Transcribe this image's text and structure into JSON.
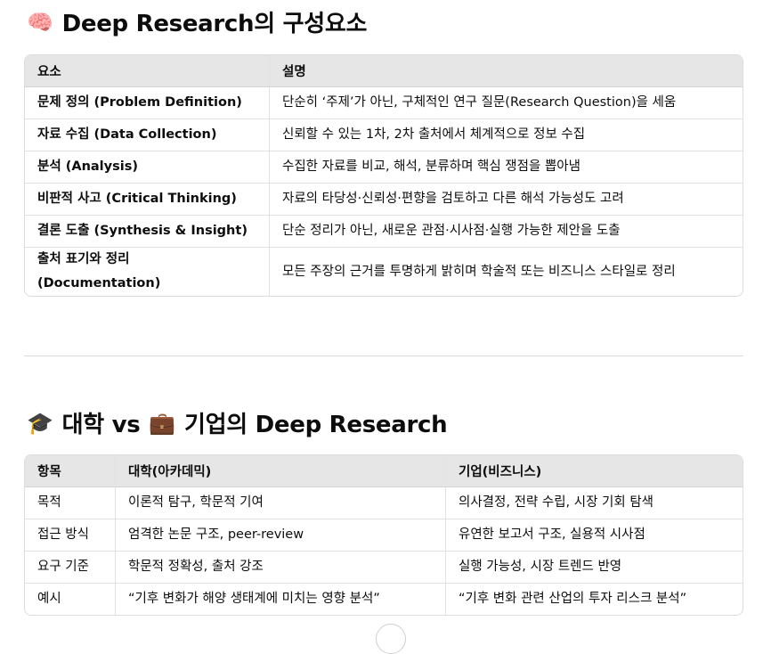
{
  "section1": {
    "emoji": "🧠",
    "title": "Deep Research의 구성요소",
    "headers": [
      "요소",
      "설명"
    ],
    "rows": [
      {
        "key": "문제 정의 (Problem Definition)",
        "desc": "단순히 ‘주제’가 아닌, 구체적인 연구 질문(Research Question)을 세움"
      },
      {
        "key": "자료 수집 (Data Collection)",
        "desc": "신뢰할 수 있는 1차, 2차 출처에서 체계적으로 정보 수집"
      },
      {
        "key": "분석 (Analysis)",
        "desc": "수집한 자료를 비교, 해석, 분류하며 핵심 쟁점을 뽑아냄"
      },
      {
        "key": "비판적 사고 (Critical Thinking)",
        "desc": "자료의 타당성·신뢰성·편향을 검토하고 다른 해석 가능성도 고려"
      },
      {
        "key": "결론 도출 (Synthesis & Insight)",
        "desc": "단순 정리가 아닌, 새로운 관점·시사점·실행 가능한 제안을 도출"
      },
      {
        "key": "출처 표기와 정리 (Documentation)",
        "desc": "모든 주장의 근거를 투명하게 밝히며 학술적 또는 비즈니스 스타일로 정리"
      }
    ]
  },
  "section2": {
    "emoji1": "🎓",
    "title_a": "대학 vs",
    "emoji2": "💼",
    "title_b": "기업의 Deep Research",
    "headers": [
      "항목",
      "대학(아카데믹)",
      "기업(비즈니스)"
    ],
    "rows": [
      {
        "item": "목적",
        "academic": "이론적 탐구, 학문적 기여",
        "business": "의사결정, 전략 수립, 시장 기회 탐색"
      },
      {
        "item": "접근 방식",
        "academic": "엄격한 논문 구조, peer-review",
        "business": "유연한 보고서 구조, 실용적 시사점"
      },
      {
        "item": "요구 기준",
        "academic": "학문적 정확성, 출처 강조",
        "business": "실행 가능성, 시장 트렌드 반영"
      },
      {
        "item": "예시",
        "academic": "“기후 변화가 해양 생태계에 미치는 영향 분석”",
        "business": "“기후 변화 관련 산업의 투자 리스크 분석”"
      }
    ]
  }
}
